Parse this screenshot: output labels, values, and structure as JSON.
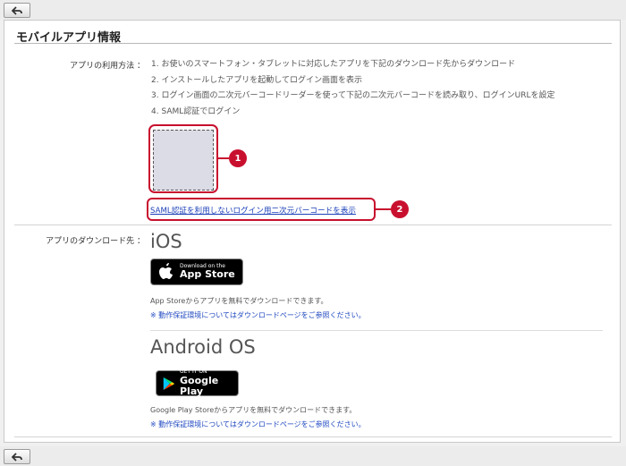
{
  "page": {
    "title": "モバイルアプリ情報"
  },
  "usage": {
    "label": "アプリの利用方法 ：",
    "steps": [
      "1. お使いのスマートフォン・タブレットに対応したアプリを下記のダウンロード先からダウンロード",
      "2. インストールしたアプリを起動してログイン画面を表示",
      "3. ログイン画面の二次元バーコードリーダーを使って下記の二次元バーコードを読み取り、ログインURLを設定",
      "4. SAML認証でログイン"
    ],
    "qr_link": "SAML認証を利用しないログイン用二次元バーコードを表示",
    "callouts": [
      "1",
      "2"
    ]
  },
  "download": {
    "label": "アプリのダウンロード先 ：",
    "ios": {
      "title": "iOS",
      "badge_small": "Download on the",
      "badge_big": "App Store",
      "desc": "App Storeからアプリを無料でダウンロードできます。",
      "note": "※ 動作保証環境についてはダウンロードページをご参照ください。"
    },
    "android": {
      "title": "Android OS",
      "badge_small": "GET IT ON",
      "badge_big": "Google Play",
      "desc": "Google Play Storeからアプリを無料でダウンロードできます。",
      "note": "※ 動作保証環境についてはダウンロードページをご参照ください。"
    }
  },
  "colors": {
    "callout": "#c8102e",
    "link": "#1a3fb8"
  },
  "icons": {
    "back": "back-arrow-icon",
    "apple": "apple-icon",
    "play": "google-play-icon"
  }
}
